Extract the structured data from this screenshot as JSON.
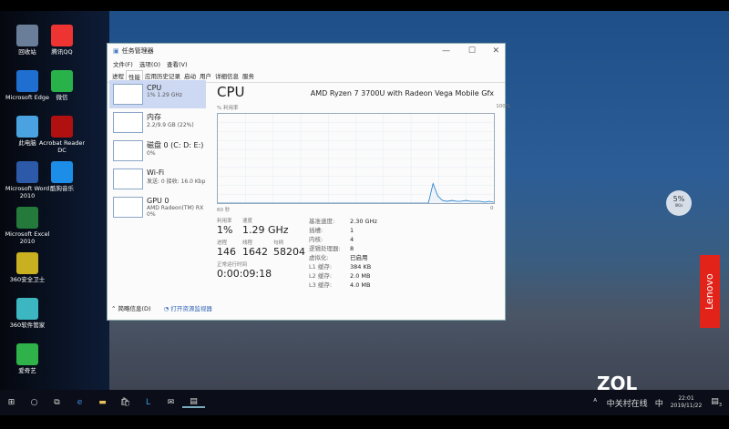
{
  "desktop": {
    "icons": [
      {
        "label": "回收站",
        "color": "#6a7d99"
      },
      {
        "label": "腾讯QQ",
        "color": "#e33"
      },
      {
        "label": "Microsoft Edge",
        "color": "#1e6fd0"
      },
      {
        "label": "微信",
        "color": "#2ab24a"
      },
      {
        "label": "此电脑",
        "color": "#4aa3e0"
      },
      {
        "label": "Acrobat Reader DC",
        "color": "#b01010"
      },
      {
        "label": "Microsoft Word 2010",
        "color": "#2c5aa8"
      },
      {
        "label": "酷狗音乐",
        "color": "#1c8ee8"
      },
      {
        "label": "Microsoft Excel 2010",
        "color": "#237a3b"
      },
      {
        "label": "360安全卫士",
        "color": "#c8b020"
      },
      {
        "label": "360软件管家",
        "color": "#3cb6c0"
      },
      {
        "label": "爱奇艺",
        "color": "#2fb24a"
      }
    ],
    "widget": {
      "percent": "5%",
      "speed": "0K/s"
    },
    "brand": "Lenovo",
    "watermark": "ZOL",
    "watermark_sub": "中关村在线"
  },
  "window": {
    "title": "任务管理器",
    "menu": [
      "文件(F)",
      "选项(O)",
      "查看(V)"
    ],
    "tabs": [
      "进程",
      "性能",
      "应用历史记录",
      "启动",
      "用户",
      "详细信息",
      "服务"
    ],
    "active_tab": 1,
    "sidebar": [
      {
        "name": "CPU",
        "value": "1% 1.29 GHz"
      },
      {
        "name": "内存",
        "value": "2.2/9.9 GB (22%)"
      },
      {
        "name": "磁盘 0 (C: D: E:)",
        "value": "0%"
      },
      {
        "name": "Wi-Fi",
        "value": "发送: 0 接收: 16.0 Kbp"
      },
      {
        "name": "GPU 0",
        "value": "AMD Radeon(TM) RX",
        "value2": "0%"
      }
    ],
    "cpu": {
      "title": "CPU",
      "model": "AMD Ryzen 7 3700U with Radeon Vega Mobile Gfx",
      "usage_label": "% 利用率",
      "max": "100%",
      "time_label": "60 秒",
      "min": "0",
      "usage_series": [
        0,
        0,
        0,
        0,
        0,
        0,
        0,
        0,
        0,
        0,
        0,
        0,
        0,
        0,
        0,
        0,
        0,
        0,
        0,
        0,
        0,
        0,
        0,
        0,
        0,
        0,
        0,
        0,
        0,
        0,
        0,
        0,
        0,
        0,
        0,
        0,
        0,
        0,
        0,
        0,
        0,
        0,
        0,
        0,
        0,
        0,
        22,
        8,
        3,
        2,
        3,
        2,
        2,
        3,
        2,
        2,
        2,
        1,
        2,
        1
      ],
      "stats": [
        {
          "label": "利用率",
          "value": "1%"
        },
        {
          "label": "速度",
          "value": "1.29 GHz"
        },
        {
          "label": "进程",
          "value": "146"
        },
        {
          "label": "线程",
          "value": "1642"
        },
        {
          "label": "句柄",
          "value": "58204"
        },
        {
          "label": "正常运行时间",
          "value": "0:00:09:18"
        }
      ],
      "specs": [
        [
          "基准速度:",
          "2.30 GHz"
        ],
        [
          "插槽:",
          "1"
        ],
        [
          "内核:",
          "4"
        ],
        [
          "逻辑处理器:",
          "8"
        ],
        [
          "虚拟化:",
          "已启用"
        ],
        [
          "L1 缓存:",
          "384 KB"
        ],
        [
          "L2 缓存:",
          "2.0 MB"
        ],
        [
          "L3 缓存:",
          "4.0 MB"
        ]
      ]
    },
    "footer": {
      "less": "简略信息(D)",
      "monitor": "打开资源监视器"
    }
  },
  "taskbar": {
    "time": "22:01",
    "date": "2019/11/22",
    "ime": "中",
    "notifications": "3"
  }
}
